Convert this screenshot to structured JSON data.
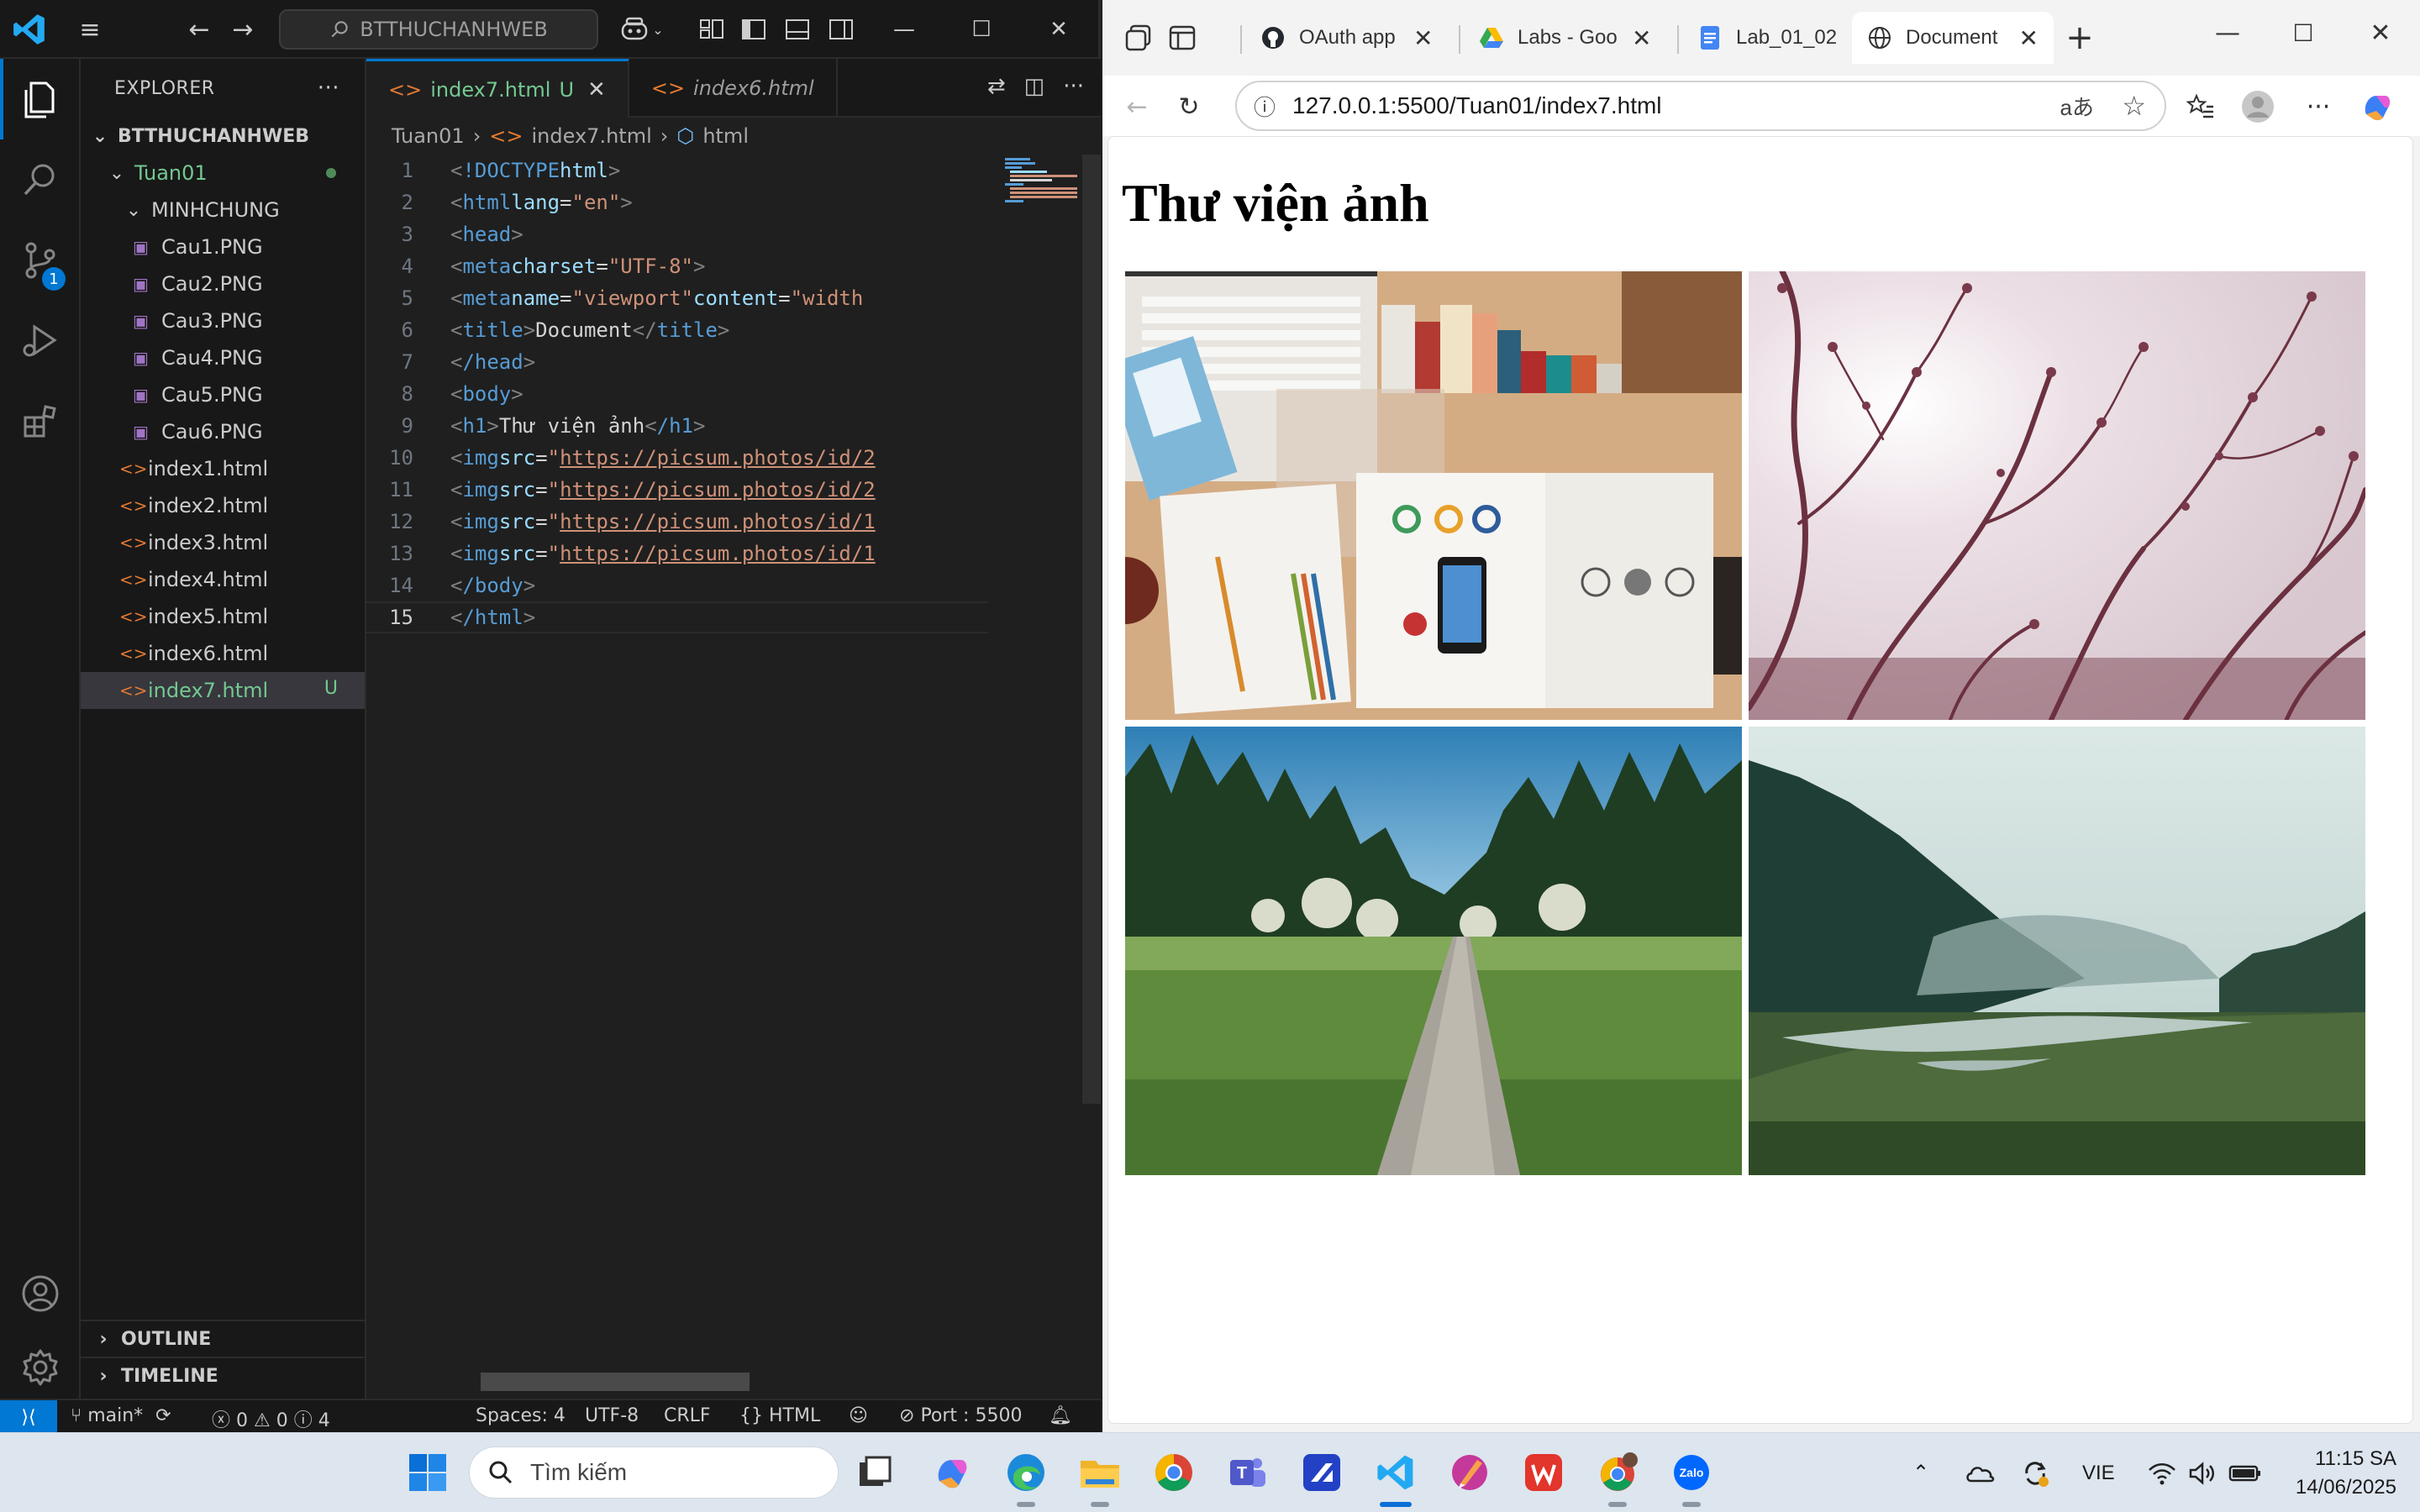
{
  "vscode": {
    "search_text": "BTTHUCHANHWEB",
    "scm_badge": "1",
    "explorer_title": "EXPLORER",
    "explorer_more": "···",
    "workspace": "BTTHUCHANHWEB",
    "folder": "Tuan01",
    "subfolder": "MINHCHUNG",
    "images": [
      "Cau1.PNG",
      "Cau2.PNG",
      "Cau3.PNG",
      "Cau4.PNG",
      "Cau5.PNG",
      "Cau6.PNG"
    ],
    "html_files": [
      "index1.html",
      "index2.html",
      "index3.html",
      "index4.html",
      "index5.html",
      "index6.html",
      "index7.html"
    ],
    "untracked_marker": "U",
    "outline": "OUTLINE",
    "timeline": "TIMELINE",
    "tabs": [
      {
        "label": "index7.html",
        "status": "U"
      },
      {
        "label": "index6.html"
      }
    ],
    "breadcrumb": [
      "Tuan01",
      "index7.html",
      "html"
    ],
    "code": {
      "l1": {
        "decl": "!DOCTYPE",
        "name": "html"
      },
      "l2": {
        "tag": "html",
        "attr": "lang",
        "val": "\"en\""
      },
      "l3": {
        "tag": "head"
      },
      "l4": {
        "tag": "meta",
        "attr": "charset",
        "val": "\"UTF-8\""
      },
      "l5": {
        "tag": "meta",
        "attr1": "name",
        "val1": "\"viewport\"",
        "attr2": "content",
        "val2": "\"width"
      },
      "l6": {
        "tag": "title",
        "text": "Document"
      },
      "l7": {
        "tag": "/head"
      },
      "l8": {
        "tag": "body"
      },
      "l9": {
        "tag": "h1",
        "text": "Thư viện ảnh",
        "close": "/h1"
      },
      "img_tag": "img",
      "src_attr": "src",
      "l10": "https://picsum.photos/id/2",
      "l11": "https://picsum.photos/id/2",
      "l12": "https://picsum.photos/id/1",
      "l13": "https://picsum.photos/id/1",
      "l14": {
        "tag": "/body"
      },
      "l15": {
        "tag": "/html"
      }
    },
    "status": {
      "branch": "main*",
      "errors": "0",
      "warnings": "0",
      "info": "4",
      "spaces": "Spaces: 4",
      "encoding": "UTF-8",
      "eol": "CRLF",
      "language": "HTML",
      "port": "Port : 5500"
    }
  },
  "browser": {
    "tabs": [
      {
        "title": "OAuth app"
      },
      {
        "title": "Labs - Goo"
      },
      {
        "title": "Lab_01_02"
      },
      {
        "title": "Document"
      }
    ],
    "address": "127.0.0.1:5500/Tuan01/index7.html",
    "read_aloud": "aあ",
    "page_heading": "Thư viện ảnh"
  },
  "taskbar": {
    "search_placeholder": "Tìm kiếm",
    "language": "VIE",
    "time": "11:15 SA",
    "date": "14/06/2025"
  },
  "colors": {
    "vscode_accent": "#0078d4",
    "untracked_green": "#73c991"
  }
}
